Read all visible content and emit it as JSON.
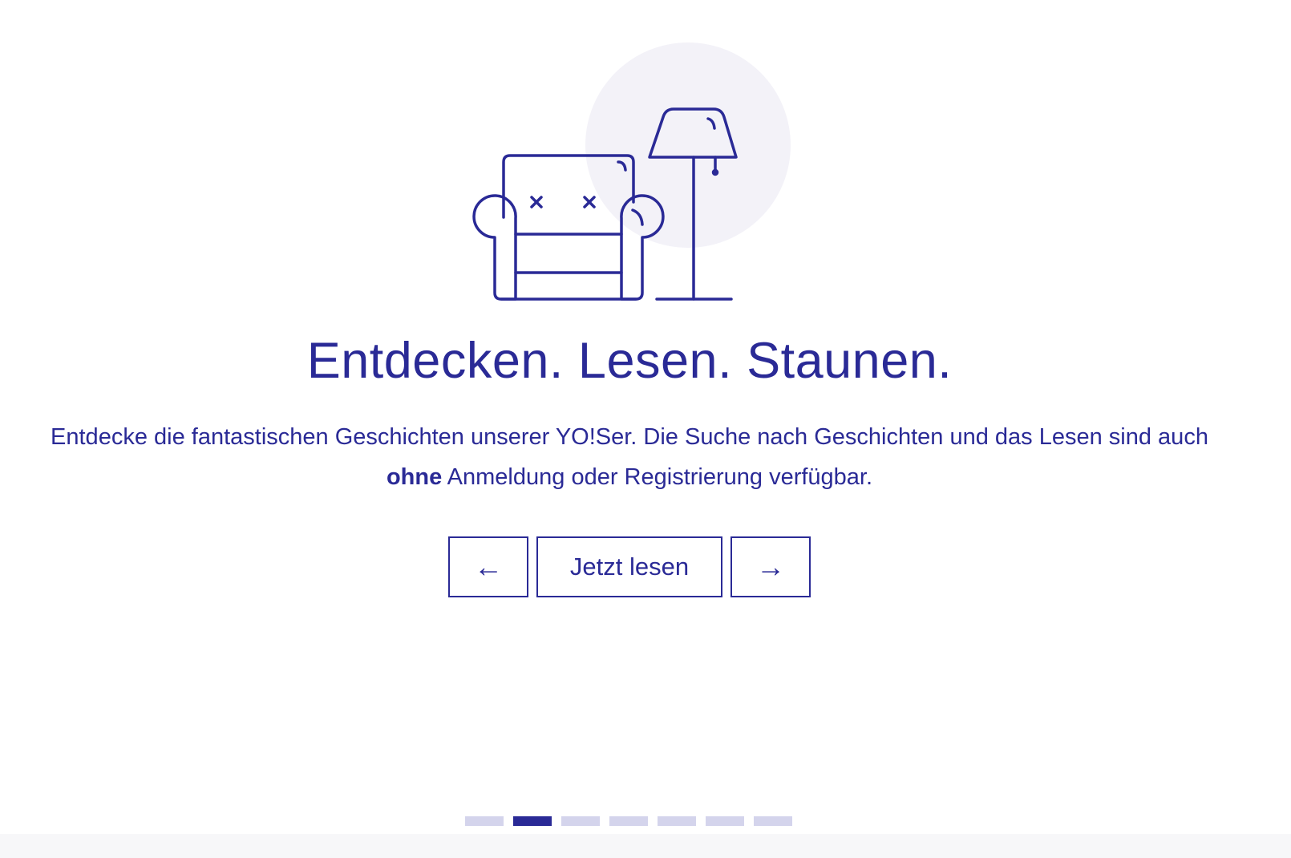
{
  "hero": {
    "title": "Entdecken. Lesen. Staunen.",
    "description_before_bold": "Entdecke die fantastischen Geschichten unserer YO!Ser. Die Suche nach Geschichten und das Lesen sind auch ",
    "description_bold": "ohne",
    "description_after_bold": " Anmeldung oder Registrierung verfügbar."
  },
  "controls": {
    "prev_label": "←",
    "read_label": "Jetzt lesen",
    "next_label": "→"
  },
  "pagination": {
    "total": 7,
    "active_index": 1
  },
  "colors": {
    "accent": "#2a2a96",
    "circle_bg": "#f3f2f8",
    "dot_inactive": "#d4d4ec"
  },
  "icons": {
    "illustration": "armchair-and-floor-lamp"
  }
}
